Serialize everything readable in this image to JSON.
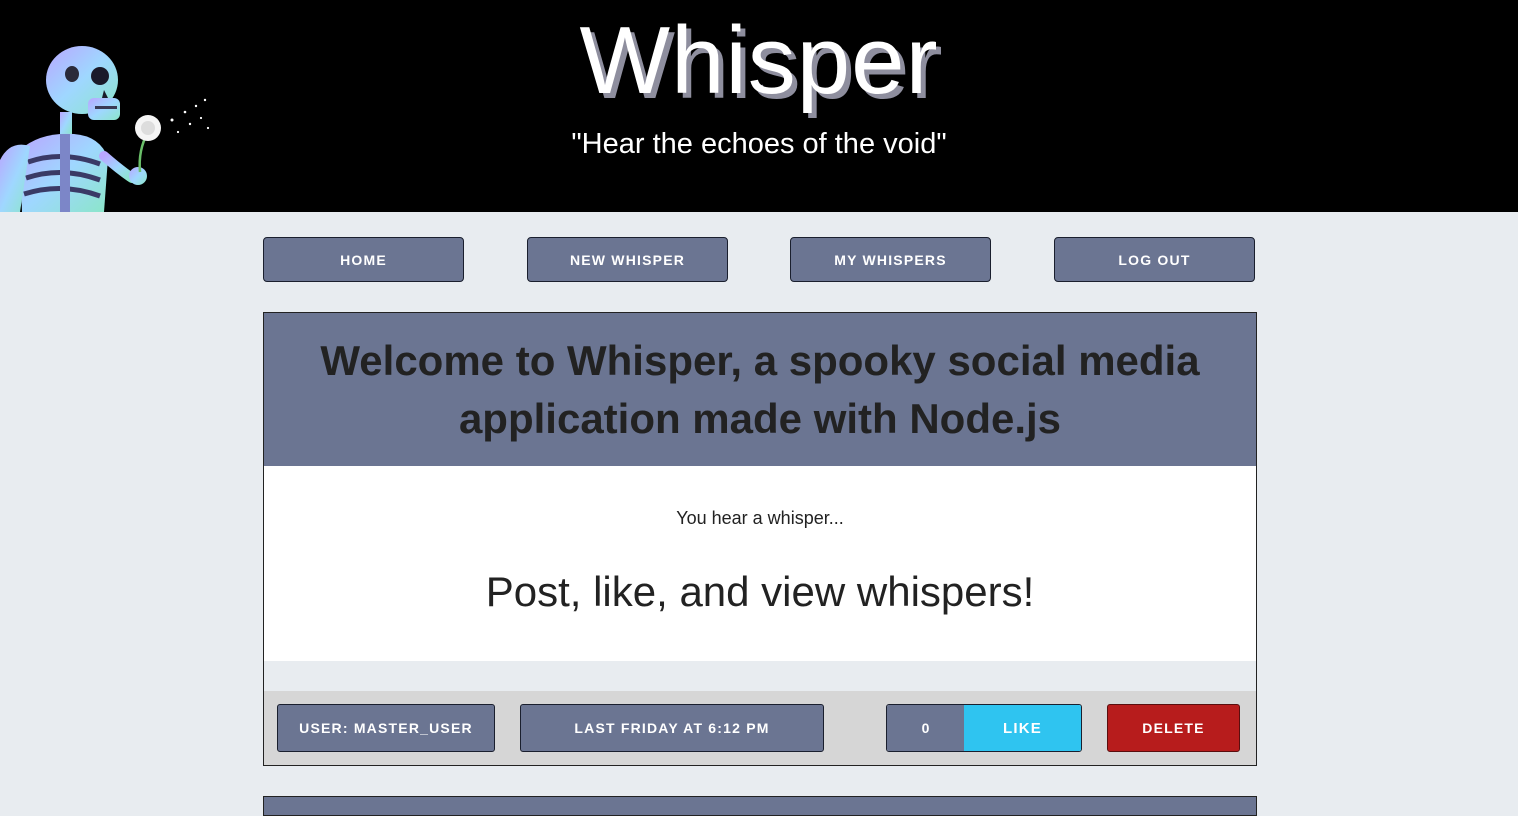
{
  "header": {
    "title": "Whisper",
    "tagline": "\"Hear the echoes of the void\""
  },
  "nav": {
    "home": "HOME",
    "new_whisper": "NEW WHISPER",
    "my_whispers": "MY WHISPERS",
    "log_out": "LOG OUT"
  },
  "post": {
    "title": "Welcome to Whisper, a spooky social media application made with Node.js",
    "intro": "You hear a whisper...",
    "content": "Post, like, and view whispers!",
    "user": "USER: MASTER_USER",
    "timestamp": "LAST FRIDAY AT 6:12 PM",
    "like_count": "0",
    "like_label": "LIKE",
    "delete_label": "DELETE"
  },
  "colors": {
    "banner": "#000000",
    "page_background": "#e8ecf0",
    "accent": "#6b7592",
    "like": "#2fc4f0",
    "delete": "#b71c1c"
  },
  "icons": {
    "banner_art": "skeleton-blowing-dandelion-icon"
  }
}
